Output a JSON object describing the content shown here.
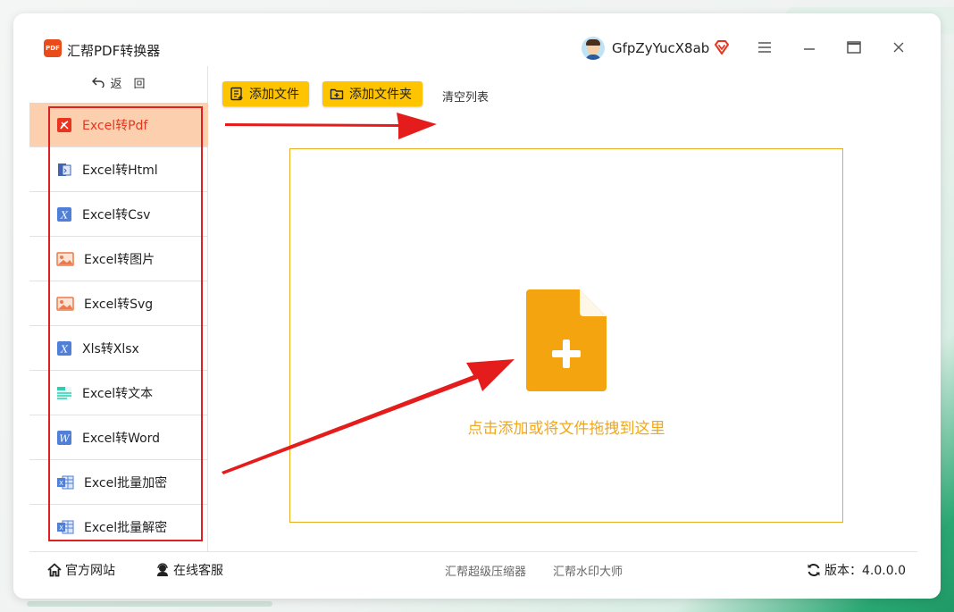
{
  "app": {
    "title": "汇帮PDF转换器",
    "logo_text": "PDF"
  },
  "user": {
    "name": "GfpZyYucX8ab"
  },
  "nav": {
    "back_label": "返　回"
  },
  "sidebar": {
    "items": [
      {
        "label": "Excel转Pdf",
        "icon": "pdf-icon",
        "active": true
      },
      {
        "label": "Excel转Html",
        "icon": "html-icon"
      },
      {
        "label": "Excel转Csv",
        "icon": "excel-x-icon"
      },
      {
        "label": "Excel转图片",
        "icon": "image-icon"
      },
      {
        "label": "Excel转Svg",
        "icon": "image-icon"
      },
      {
        "label": "Xls转Xlsx",
        "icon": "excel-x-icon"
      },
      {
        "label": "Excel转文本",
        "icon": "text-icon"
      },
      {
        "label": "Excel转Word",
        "icon": "word-icon"
      },
      {
        "label": "Excel批量加密",
        "icon": "excel-sheet-icon"
      },
      {
        "label": "Excel批量解密",
        "icon": "excel-sheet-icon"
      }
    ]
  },
  "toolbar": {
    "add_file": "添加文件",
    "add_folder": "添加文件夹",
    "clear_list": "清空列表"
  },
  "dropzone": {
    "hint": "点击添加或将文件拖拽到这里"
  },
  "footer": {
    "official_site": "官方网站",
    "online_service": "在线客服",
    "compressor": "汇帮超级压缩器",
    "watermark": "汇帮水印大师",
    "version_label": "版本：4.0.0.0"
  },
  "colors": {
    "accent_yellow": "#ffc400",
    "active_bg": "#fcd0ae",
    "active_text": "#e8351f",
    "drop_border": "#e9ad24",
    "drop_icon": "#f3a40f",
    "annotation_red": "#e02020"
  }
}
